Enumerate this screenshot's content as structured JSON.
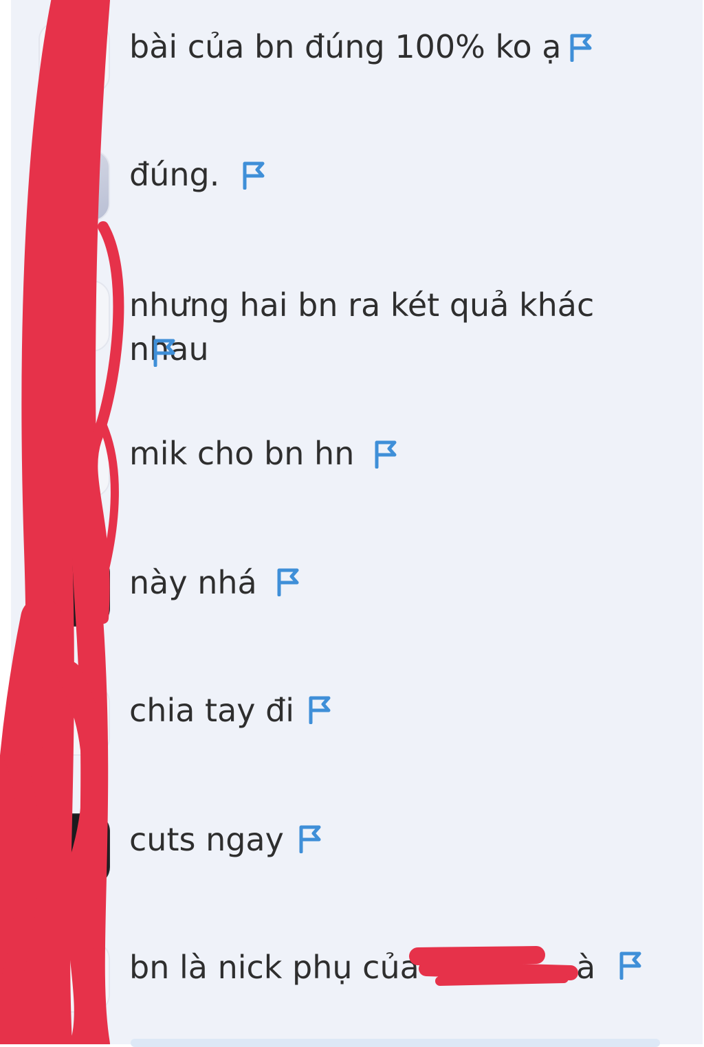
{
  "colors": {
    "background": "#eff2f9",
    "text": "#2e2e2e",
    "flag": "#3f8fd8",
    "redaction": "#e6324a"
  },
  "comments": [
    {
      "text": "bài của bn đúng 100% ko ạ",
      "icon": "flag-icon"
    },
    {
      "text": "đúng.",
      "icon": "flag-icon"
    },
    {
      "text": "nhưng hai bn ra két quả khác nhau",
      "icon": "flag-icon"
    },
    {
      "text": "mik cho bn hn",
      "icon": "flag-icon"
    },
    {
      "text": "này nhá",
      "icon": "flag-icon"
    },
    {
      "text": "chia tay đi",
      "icon": "flag-icon"
    },
    {
      "text": "cuts ngay",
      "icon": "flag-icon"
    },
    {
      "text_before": "bn là nick phụ của",
      "text_after": "à",
      "icon": "flag-icon"
    }
  ]
}
